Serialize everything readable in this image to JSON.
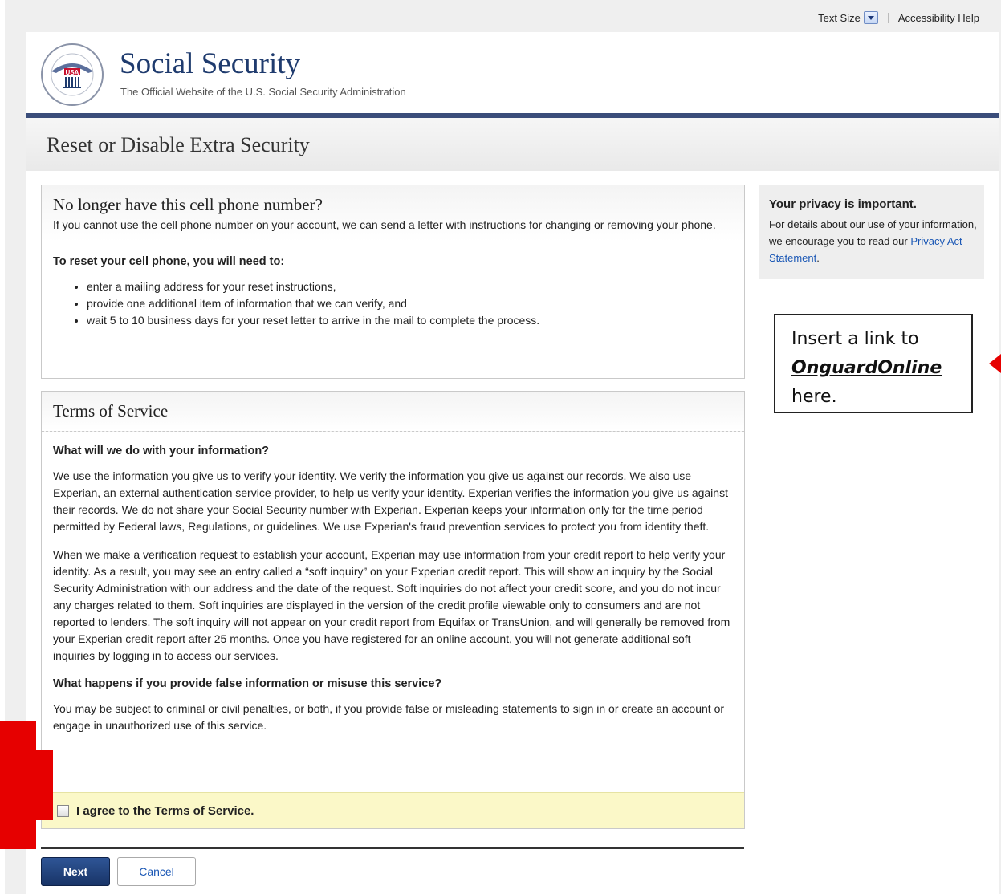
{
  "utility": {
    "text_size": "Text Size",
    "accessibility_help": "Accessibility Help"
  },
  "header": {
    "brand": "Social Security",
    "tagline": "The Official Website of the U.S. Social Security Administration",
    "seal_text": "USA"
  },
  "page_title": "Reset or Disable Extra Security",
  "phone_box": {
    "title": "No longer have this cell phone number?",
    "intro": "If you cannot use the cell phone number on your account, we can send a letter with instructions for changing or removing your phone.",
    "need_heading": "To reset your cell phone, you will need to:",
    "items": [
      "enter a mailing address for your reset instructions,",
      "provide one additional item of information that we can verify, and",
      "wait 5 to 10 business days for your reset letter to arrive in the mail to complete the process."
    ]
  },
  "terms_box": {
    "title": "Terms of Service",
    "q1": "What will we do with your information?",
    "p1": "We use the information you give us to verify your identity. We verify the information you give us against our records. We also use Experian, an external authentication service provider, to help us verify your identity. Experian verifies the information you give us against their records. We do not share your Social Security number with Experian. Experian keeps your information only for the time period permitted by Federal laws, Regulations, or guidelines. We use Experian's fraud prevention services to protect you from identity theft.",
    "p2": "When we make a verification request to establish your account, Experian may use information from your credit report to help verify your identity. As a result, you may see an entry called a “soft inquiry” on your Experian credit report. This will show an inquiry by the Social Security Administration with our address and the date of the request. Soft inquiries do not affect your credit score, and you do not incur any charges related to them. Soft inquiries are displayed in the version of the credit profile viewable only to consumers and are not reported to lenders. The soft inquiry will not appear on your credit report from Equifax or TransUnion, and will generally be removed from your Experian credit report after 25 months. Once you have registered for an online account, you will not generate additional soft inquiries by logging in to access our services.",
    "q2": "What happens if you provide false information or misuse this service?",
    "p3": "You may be subject to criminal or civil penalties, or both, if you provide false or misleading statements to sign in or create an account or engage in unauthorized use of this service.",
    "agree_label": "I agree to the Terms of Service."
  },
  "sidebar": {
    "title": "Your privacy is important.",
    "text": "For details about our use of your information, we encourage you to read our ",
    "link": "Privacy Act Statement",
    "end": "."
  },
  "annotation": {
    "line1": "Insert a link to",
    "link": "OnguardOnline ",
    "line3": "here."
  },
  "buttons": {
    "next": "Next",
    "cancel": "Cancel"
  },
  "colors": {
    "brand_blue": "#1f3b6e",
    "nav_bar": "#3a4d7a",
    "link_blue": "#1a57b5",
    "agree_yellow": "#fbf8c8",
    "callout_red": "#e60000"
  }
}
